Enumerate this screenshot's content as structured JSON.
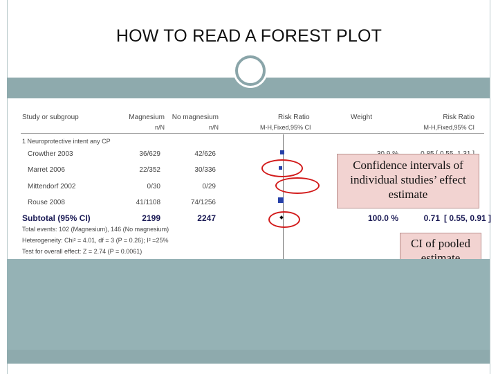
{
  "slide": {
    "title": "HOW TO READ A FOREST PLOT"
  },
  "forest_plot": {
    "columns": {
      "study": "Study or subgroup",
      "group1": "Magnesium",
      "group1_sub": "n/N",
      "group2": "No magnesium",
      "group2_sub": "n/N",
      "rr": "Risk Ratio",
      "rr_sub": "M-H,Fixed,95% CI",
      "weight": "Weight",
      "rr2": "Risk Ratio",
      "rr2_sub": "M-H,Fixed,95% CI"
    },
    "subgroup_title": "1 Neuroprotective intent any CP",
    "studies": [
      {
        "name": "Crowther 2003",
        "g1": "36/629",
        "g2": "42/626",
        "weight": "30.9 %",
        "ci": "0.85 [ 0.55, 1.31 ]"
      },
      {
        "name": "Marret 2006",
        "g1": "22/352",
        "g2": "30/336",
        "weight": "",
        "ci": ""
      },
      {
        "name": "Mittendorf 2002",
        "g1": "0/30",
        "g2": "0/29",
        "weight": "",
        "ci": ""
      },
      {
        "name": "Rouse 2008",
        "g1": "41/1108",
        "g2": "74/1256",
        "weight": "",
        "ci": ""
      }
    ],
    "subtotal": {
      "label": "Subtotal (95% CI)",
      "g1": "2199",
      "g2": "2247",
      "weight": "100.0 %",
      "est": "0.71",
      "ci": "[ 0.55, 0.91 ]"
    },
    "footnotes": [
      "Total events: 102 (Magnesium), 146 (No magnesium)",
      "Heterogeneity: Chi² = 4.01, df = 3 (P = 0.26); I² =25%",
      "Test for overall effect: Z = 2.74 (P = 0.0061)"
    ]
  },
  "callouts": {
    "individual_ci": "Confidence intervals of individual studies’ effect estimate",
    "pooled_ci": "CI of pooled estimate"
  },
  "colors": {
    "accent_band": "#8eaaad",
    "lower_pane": "#95b2b5",
    "marker": "#2640a8",
    "highlight": "#d21a1a",
    "callout_fill": "#f2d3d1"
  }
}
